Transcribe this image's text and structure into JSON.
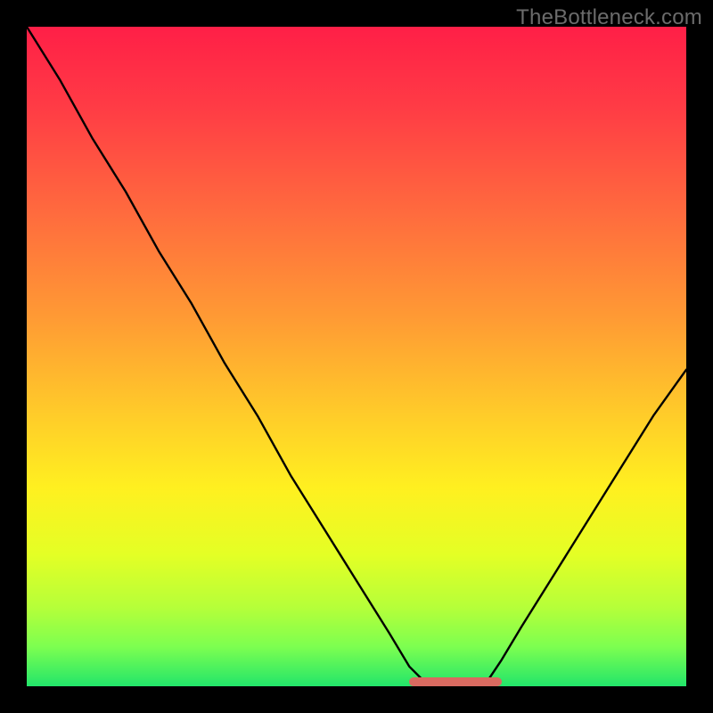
{
  "watermark": "TheBottleneck.com",
  "chart_data": {
    "type": "line",
    "title": "",
    "xlabel": "",
    "ylabel": "",
    "xlim": [
      0,
      100
    ],
    "ylim": [
      0,
      100
    ],
    "grid": false,
    "legend": false,
    "series": [
      {
        "name": "bottleneck-curve",
        "color": "#000000",
        "x": [
          0,
          5,
          10,
          15,
          20,
          25,
          30,
          35,
          40,
          45,
          50,
          55,
          58,
          60,
          62,
          65,
          68,
          70,
          72,
          75,
          80,
          85,
          90,
          95,
          100
        ],
        "y": [
          100,
          92,
          83,
          75,
          66,
          58,
          49,
          41,
          32,
          24,
          16,
          8,
          3,
          1,
          0,
          0,
          0,
          1,
          4,
          9,
          17,
          25,
          33,
          41,
          48
        ]
      }
    ],
    "annotations": [
      {
        "name": "optimal-range-marker",
        "type": "segment",
        "x_start": 58,
        "x_end": 72,
        "y": 0,
        "color": "#d96a60"
      }
    ],
    "background_gradient": {
      "type": "vertical",
      "stops": [
        {
          "offset": 0.0,
          "color": "#ff1f47"
        },
        {
          "offset": 0.12,
          "color": "#ff3b45"
        },
        {
          "offset": 0.28,
          "color": "#ff6a3e"
        },
        {
          "offset": 0.44,
          "color": "#ff9a34"
        },
        {
          "offset": 0.58,
          "color": "#ffc92a"
        },
        {
          "offset": 0.7,
          "color": "#fff020"
        },
        {
          "offset": 0.8,
          "color": "#e4ff25"
        },
        {
          "offset": 0.88,
          "color": "#b6ff39"
        },
        {
          "offset": 0.94,
          "color": "#7dff50"
        },
        {
          "offset": 1.0,
          "color": "#22e56a"
        }
      ]
    }
  }
}
